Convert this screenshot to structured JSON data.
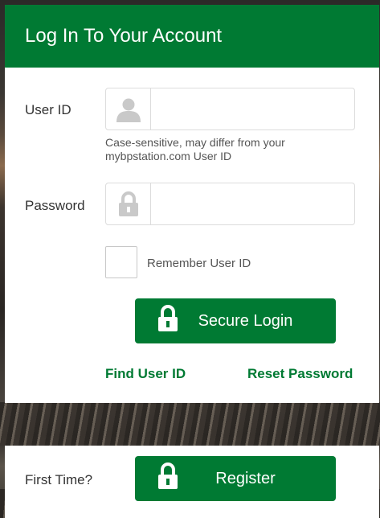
{
  "login": {
    "header_title": "Log In To Your Account",
    "user_id_label": "User ID",
    "user_id_value": "",
    "user_id_hint": "Case-sensitive, may differ from your mybpstation.com User ID",
    "password_label": "Password",
    "password_value": "",
    "remember_label": "Remember User ID",
    "remember_checked": false,
    "secure_login_label": "Secure Login",
    "find_user_id_label": "Find User ID",
    "reset_password_label": "Reset Password"
  },
  "register": {
    "first_time_label": "First Time?",
    "register_label": "Register"
  },
  "colors": {
    "brand_green": "#007a33",
    "icon_gray": "#c9c9c9"
  },
  "icons": {
    "user_field": "user-icon",
    "password_field": "lock-icon",
    "buttons": "lock-icon"
  }
}
